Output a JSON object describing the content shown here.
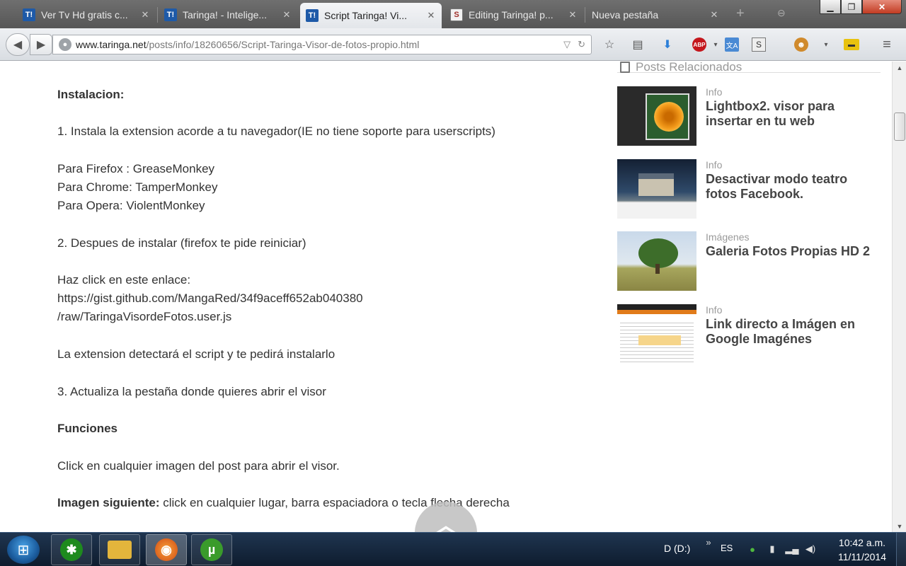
{
  "browser": {
    "tabs": [
      {
        "title": "Ver Tv Hd gratis c...",
        "favicon": "T!",
        "active": false
      },
      {
        "title": "Taringa! - Intelige...",
        "favicon": "T!",
        "active": false
      },
      {
        "title": "Script Taringa! Vi...",
        "favicon": "T!",
        "active": true
      },
      {
        "title": "Editing Taringa! p...",
        "favicon": "S",
        "active": false
      },
      {
        "title": "Nueva pestaña",
        "favicon": "",
        "active": false
      }
    ],
    "url_host": "www.taringa.net",
    "url_path": "/posts/info/18260656/Script-Taringa-Visor-de-fotos-propio.html"
  },
  "article": {
    "lines": [
      {
        "text": "Instalacion:",
        "bold": true
      },
      {
        "text": "1. Instala la extension acorde a tu navegador(IE no tiene soporte para userscripts)"
      },
      {
        "text": "Para Firefox : GreaseMonkey"
      },
      {
        "text": "Para Chrome: TamperMonkey"
      },
      {
        "text": "Para Opera: ViolentMonkey"
      },
      {
        "text": "2. Despues de instalar (firefox te pide reiniciar)"
      },
      {
        "text": "Haz click en este enlace:"
      },
      {
        "text": "https://gist.github.com/MangaRed/34f9aceff652ab040380"
      },
      {
        "text": "/raw/TaringaVisordeFotos.user.js"
      },
      {
        "text": "La extension detectará el script y te pedirá instalarlo"
      },
      {
        "text": "3. Actualiza la pestaña donde quieres abrir el visor"
      },
      {
        "text": "Funciones",
        "bold": true
      },
      {
        "text": "Click en cualquier imagen del post para abrir el visor."
      },
      {
        "label": "Imagen siguiente:",
        "text": " click en cualquier lugar, barra espaciadora o tecla flecha derecha"
      }
    ]
  },
  "sidebar": {
    "header": "Posts Relacionados",
    "items": [
      {
        "category": "Info",
        "title": "Lightbox2. visor para insertar en tu web"
      },
      {
        "category": "Info",
        "title": "Desactivar modo teatro fotos Facebook."
      },
      {
        "category": "Imágenes",
        "title": "Galeria Fotos Propias HD 2"
      },
      {
        "category": "Info",
        "title": "Link directo a Imágen en Google Imagénes"
      }
    ]
  },
  "taskbar": {
    "drive": "D (D:)",
    "language": "ES",
    "time": "10:42 a.m.",
    "date": "11/11/2014"
  },
  "icons": {
    "back": "back-arrow-icon",
    "forward": "forward-arrow-icon",
    "reload": "reload-icon",
    "star": "bookmark-star-icon",
    "scroll_top": "chevron-up-icon"
  }
}
